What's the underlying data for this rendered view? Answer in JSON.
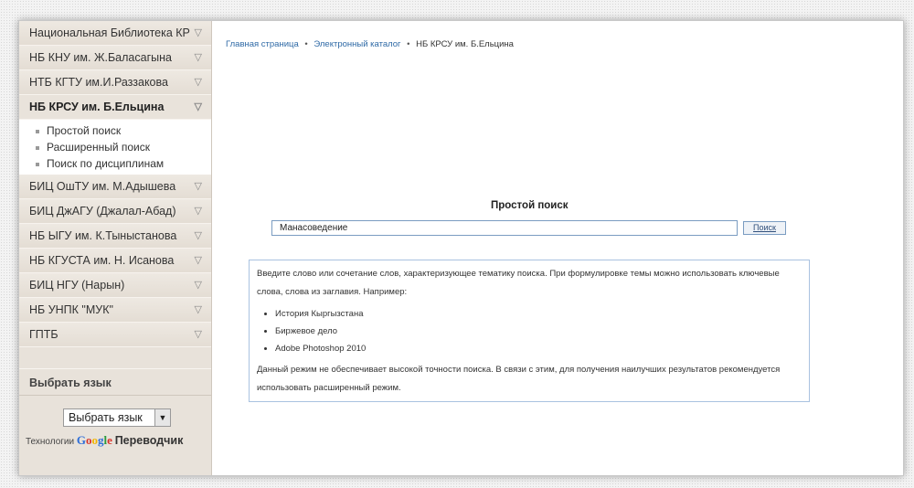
{
  "sidebar": {
    "items": [
      {
        "label": "Национальная Библиотека КР",
        "active": false
      },
      {
        "label": "НБ КНУ им. Ж.Баласагына",
        "active": false
      },
      {
        "label": "НТБ КГТУ им.И.Раззакова",
        "active": false
      },
      {
        "label": "НБ КРСУ им. Б.Ельцина",
        "active": true
      },
      {
        "label": "БИЦ ОшТУ им. М.Адышева",
        "active": false
      },
      {
        "label": "БИЦ ДжАГУ (Джалал-Абад)",
        "active": false
      },
      {
        "label": "НБ ЫГУ им. К.Тыныстанова",
        "active": false
      },
      {
        "label": "НБ КГУСТА им. Н. Исанова",
        "active": false
      },
      {
        "label": "БИЦ НГУ (Нарын)",
        "active": false
      },
      {
        "label": "НБ УНПК \"МУК\"",
        "active": false
      },
      {
        "label": "ГПТБ",
        "active": false
      }
    ],
    "subitems": [
      "Простой поиск",
      "Расширенный поиск",
      "Поиск по дисциплинам"
    ],
    "language_header": "Выбрать язык",
    "language_select": "Выбрать язык",
    "powered_prefix": "Технологии",
    "google": "Google",
    "translator": "Переводчик"
  },
  "breadcrumb": {
    "home": "Главная страница",
    "catalog": "Электронный каталог",
    "current": "НБ КРСУ им. Б.Ельцина",
    "sep": "•"
  },
  "search": {
    "title": "Простой поиск",
    "value": "Манасоведение",
    "button": "Поиск"
  },
  "info": {
    "intro": "Введите слово или сочетание слов, характеризующее тематику поиска. При формулировке темы можно использовать ключевые слова, слова из заглавия. Например:",
    "examples": [
      "История Кыргызстана",
      "Биржевое дело",
      "Adobe Photoshop 2010"
    ],
    "note": "Данный режим не обеспечивает высокой точности поиска. В связи с этим, для получения наилучших результатов рекомендуется использовать расширенный режим."
  },
  "colors": {
    "link": "#2f6aa6",
    "sidebar_bg": "#e8e2da",
    "border_accent": "#a9c2e0"
  }
}
